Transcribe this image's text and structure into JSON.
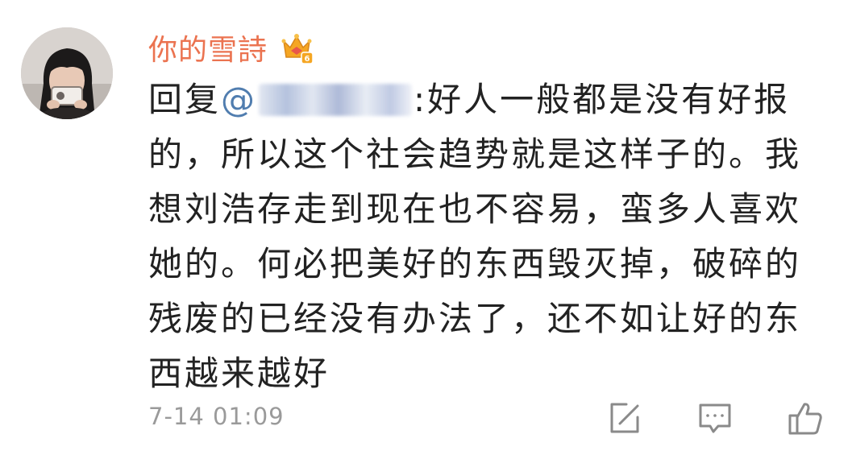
{
  "comment": {
    "username": "你的雪詩",
    "badge_icon": "vip-crown-icon",
    "reply_prefix": "回复",
    "mention_at": "@",
    "mention_separator": ":",
    "text": "好人一般都是没有好报的，所以这个社会趋势就是这样子的。我想刘浩存走到现在也不容易，蛮多人喜欢她的。何必把美好的东西毁灭掉，破碎的残废的已经没有办法了，还不如让好的东西越来越好",
    "timestamp": "7-14 01:09",
    "actions": {
      "forward_icon": "share-edit-icon",
      "reply_icon": "comment-icon",
      "like_icon": "thumbs-up-icon"
    }
  },
  "colors": {
    "username": "#eb7350",
    "mention": "#507daf",
    "text": "#222222",
    "meta": "#9a9a9a"
  }
}
